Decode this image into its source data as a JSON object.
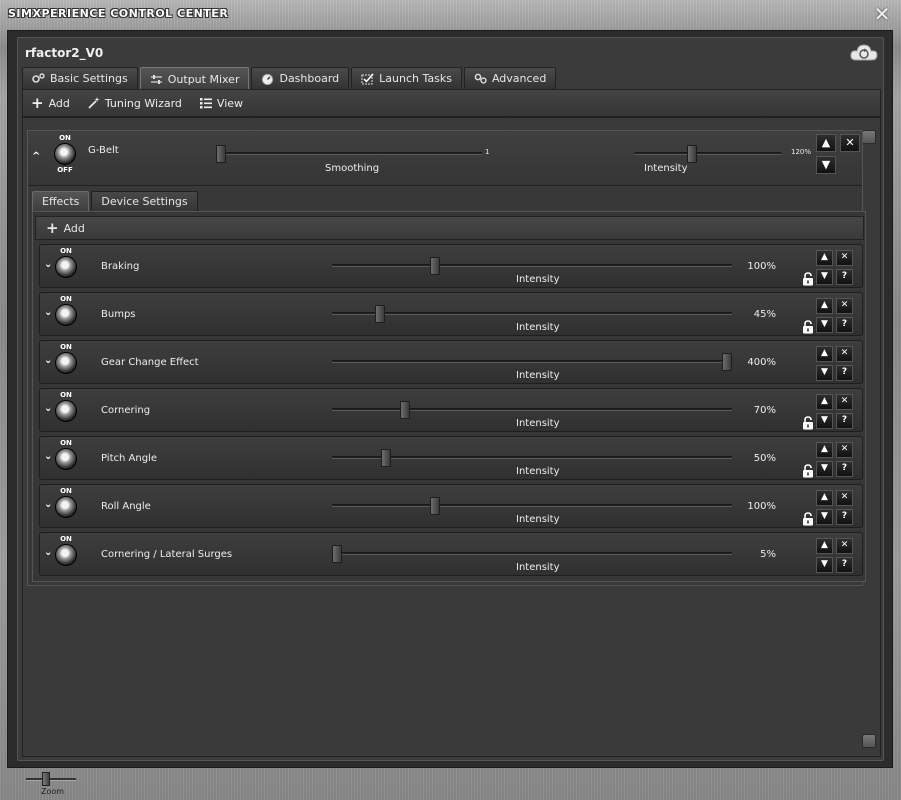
{
  "window": {
    "title": "SIMXPERIENCE CONTROL CENTER",
    "close_icon": "close-icon"
  },
  "profile": {
    "name": "rfactor2_V0",
    "cloud_icon": "cloud-sync-icon"
  },
  "tabs": [
    {
      "label": "Basic Settings",
      "icon": "gears-icon",
      "active": false
    },
    {
      "label": "Output Mixer",
      "icon": "sliders-icon",
      "active": true
    },
    {
      "label": "Dashboard",
      "icon": "gauge-icon",
      "active": false
    },
    {
      "label": "Launch Tasks",
      "icon": "checklist-icon",
      "active": false
    },
    {
      "label": "Advanced",
      "icon": "gears-icon",
      "active": false
    }
  ],
  "toolbar": {
    "add": "Add",
    "tuning_wizard": "Tuning Wizard",
    "view": "View"
  },
  "device": {
    "name": "G-Belt",
    "on_label": "ON",
    "off_label": "OFF",
    "smoothing_label": "Smoothing",
    "smoothing_value": "1",
    "smoothing_fraction": 0.0,
    "intensity_label": "Intensity",
    "intensity_value": "120%",
    "intensity_fraction": 0.38
  },
  "subtabs": [
    {
      "label": "Effects",
      "active": true
    },
    {
      "label": "Device Settings",
      "active": false
    }
  ],
  "effects_toolbar": {
    "add": "Add"
  },
  "effects": [
    {
      "name": "Braking",
      "intensity_label": "Intensity",
      "value": "100%",
      "fraction": 0.25,
      "locked": true
    },
    {
      "name": "Bumps",
      "intensity_label": "Intensity",
      "value": "45%",
      "fraction": 0.11,
      "locked": true
    },
    {
      "name": "Gear Change Effect",
      "intensity_label": "Intensity",
      "value": "400%",
      "fraction": 1.0,
      "locked": false
    },
    {
      "name": "Cornering",
      "intensity_label": "Intensity",
      "value": "70%",
      "fraction": 0.175,
      "locked": true
    },
    {
      "name": "Pitch Angle",
      "intensity_label": "Intensity",
      "value": "50%",
      "fraction": 0.125,
      "locked": true
    },
    {
      "name": "Roll Angle",
      "intensity_label": "Intensity",
      "value": "100%",
      "fraction": 0.25,
      "locked": true
    },
    {
      "name": "Cornering / Lateral Surges",
      "intensity_label": "Intensity",
      "value": "5%",
      "fraction": 0.0,
      "locked": false
    }
  ],
  "row_buttons": {
    "up": "▲",
    "down": "▼",
    "remove": "✕",
    "help": "?"
  },
  "zoom": {
    "label": "Zoom"
  }
}
